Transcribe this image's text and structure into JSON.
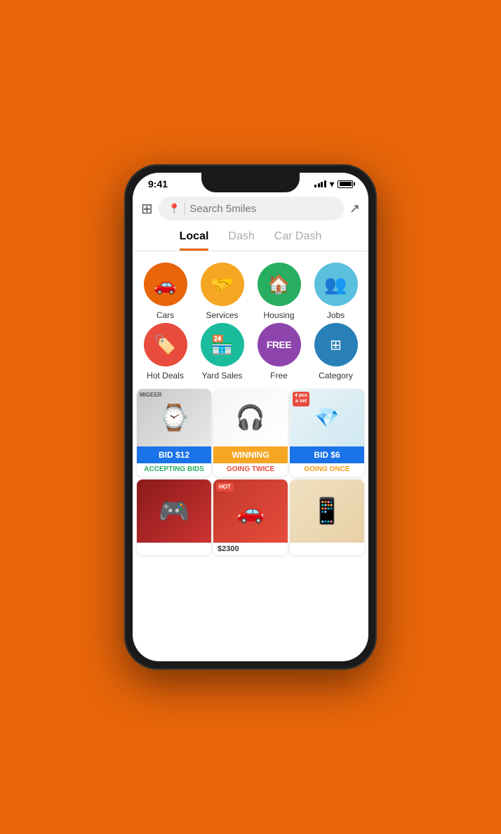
{
  "phone": {
    "status_time": "9:41",
    "background_color": "#E8650A"
  },
  "header": {
    "search_placeholder": "Search 5miles"
  },
  "tabs": [
    {
      "label": "Local",
      "active": true
    },
    {
      "label": "Dash",
      "active": false
    },
    {
      "label": "Car Dash",
      "active": false
    }
  ],
  "categories": [
    {
      "id": "cars",
      "label": "Cars",
      "color": "#E8650A",
      "icon": "🚗"
    },
    {
      "id": "services",
      "label": "Services",
      "color": "#F5A623",
      "icon": "🤝"
    },
    {
      "id": "housing",
      "label": "Housing",
      "color": "#27ae60",
      "icon": "🏠"
    },
    {
      "id": "jobs",
      "label": "Jobs",
      "color": "#5bc0de",
      "icon": "👥"
    },
    {
      "id": "hot-deals",
      "label": "Hot Deals",
      "color": "#e74c3c",
      "icon": "🏷️"
    },
    {
      "id": "yard-sales",
      "label": "Yard Sales",
      "color": "#1abc9c",
      "icon": "🏪"
    },
    {
      "id": "free",
      "label": "Free",
      "color": "#8e44ad",
      "icon": "FREE"
    },
    {
      "id": "category",
      "label": "Category",
      "color": "#2980b9",
      "icon": "⊞"
    }
  ],
  "listings": [
    {
      "id": "watch",
      "bid": "BID $12",
      "bid_color": "blue",
      "status": "ACCEPTING BIDS",
      "status_color": "accepting",
      "brand": "MIGEER"
    },
    {
      "id": "airpods",
      "bid": "WINNING",
      "bid_color": "orange",
      "status": "GOING TWICE",
      "status_color": "going-twice"
    },
    {
      "id": "jewelry",
      "bid": "BID $6",
      "bid_color": "blue",
      "status": "GOING ONCE",
      "status_color": "going-once",
      "badge": "4 pcs\na set"
    }
  ],
  "listings2": [
    {
      "id": "gameboy",
      "price": null,
      "hot": false
    },
    {
      "id": "truck",
      "price": "$2300",
      "hot": true
    },
    {
      "id": "iphone",
      "price": null,
      "hot": false
    }
  ]
}
